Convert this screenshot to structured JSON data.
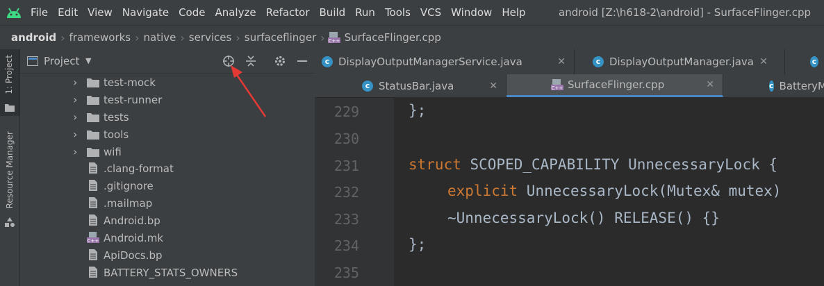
{
  "menu": {
    "items": [
      "File",
      "Edit",
      "View",
      "Navigate",
      "Code",
      "Analyze",
      "Refactor",
      "Build",
      "Run",
      "Tools",
      "VCS",
      "Window",
      "Help"
    ],
    "window_title": "android [Z:\\h618-2\\android] - SurfaceFlinger.cpp"
  },
  "breadcrumb": [
    "android",
    "frameworks",
    "native",
    "services",
    "surfaceflinger",
    "SurfaceFlinger.cpp"
  ],
  "side_strip": {
    "project_label": "1: Project",
    "resource_label": "Resource Manager"
  },
  "project_panel": {
    "title": "Project",
    "tree": [
      {
        "label": "test-mock",
        "type": "folder"
      },
      {
        "label": "test-runner",
        "type": "folder"
      },
      {
        "label": "tests",
        "type": "folder"
      },
      {
        "label": "tools",
        "type": "folder"
      },
      {
        "label": "wifi",
        "type": "folder"
      },
      {
        "label": ".clang-format",
        "type": "file"
      },
      {
        "label": ".gitignore",
        "type": "file"
      },
      {
        "label": ".mailmap",
        "type": "file"
      },
      {
        "label": "Android.bp",
        "type": "file"
      },
      {
        "label": "Android.mk",
        "type": "cpp-file"
      },
      {
        "label": "ApiDocs.bp",
        "type": "file"
      },
      {
        "label": "BATTERY_STATS_OWNERS",
        "type": "file"
      }
    ]
  },
  "tabs_row1": [
    "DisplayOutputManagerService.java",
    "DisplayOutputManager.java",
    ""
  ],
  "tabs_row2": [
    "StatusBar.java",
    "SurfaceFlinger.cpp",
    "BatteryM"
  ],
  "active_tab": "SurfaceFlinger.cpp",
  "editor": {
    "line_numbers": [
      "229",
      "230",
      "231",
      "232",
      "233",
      "234",
      "235"
    ],
    "lines": {
      "l229": "};",
      "l231_kw": "struct",
      "l231_rest": " SCOPED_CAPABILITY UnnecessaryLock {",
      "l232_kw": "explicit",
      "l232_rest": " UnnecessaryLock(Mutex& mutex)",
      "l233": "~UnnecessaryLock() RELEASE() {}",
      "l234": "};"
    }
  },
  "colors": {
    "accent_arrow": "#e53935",
    "keyword": "#cc7832",
    "tab_underline": "#4a88c7"
  }
}
